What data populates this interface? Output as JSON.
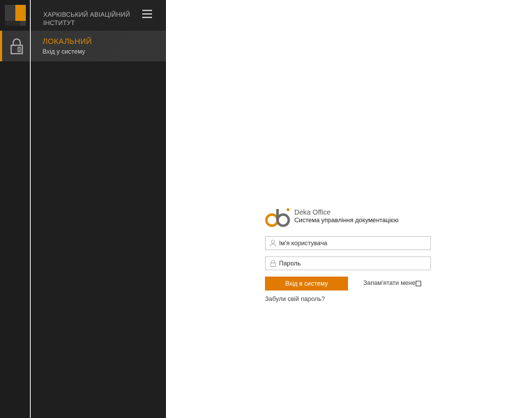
{
  "sidebar": {
    "org_name": "Харківський авіаційний інститут",
    "active_item": {
      "title": "ЛОКАЛЬНИЙ",
      "subtitle": "Вхід у систему"
    }
  },
  "login": {
    "brand_name": "Deka Office",
    "brand_subtitle": "Система управління документацією",
    "username_placeholder": "Ім'я користувача",
    "password_placeholder": "Пароль",
    "login_button": "Вхід в систему",
    "remember_label": "Запам'ятати мене",
    "remember_checked": false,
    "forgot_link": "Забули свій пароль?"
  },
  "colors": {
    "accent": "#e08a00",
    "button": "#e07a00",
    "sidebar_bg": "#1f1f1f"
  },
  "icons": {
    "rail_logo": "app-logo-icon",
    "rail_active": "lock-icon",
    "menu": "hamburger-menu-icon",
    "brand": "deka-logo-icon",
    "user": "user-icon",
    "password": "lock-icon"
  }
}
